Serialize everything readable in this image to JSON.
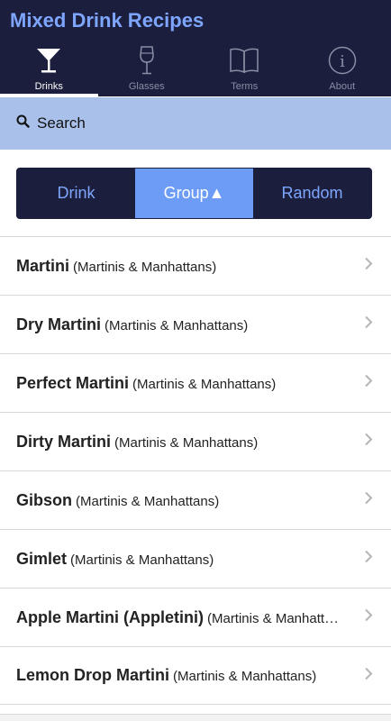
{
  "app": {
    "title": "Mixed Drink Recipes"
  },
  "tabs": [
    {
      "label": "Drinks",
      "icon": "martini-glass-icon",
      "active": true
    },
    {
      "label": "Glasses",
      "icon": "wine-glass-icon",
      "active": false
    },
    {
      "label": "Terms",
      "icon": "book-icon",
      "active": false
    },
    {
      "label": "About",
      "icon": "info-icon",
      "active": false
    }
  ],
  "search": {
    "label": "Search",
    "icon": "search-icon"
  },
  "sort": {
    "options": [
      "Drink",
      "Group▲",
      "Random"
    ],
    "selected": "Group▲"
  },
  "drinks": [
    {
      "name": "Martini",
      "group": "(Martinis & Manhattans)"
    },
    {
      "name": "Dry Martini",
      "group": "(Martinis & Manhattans)"
    },
    {
      "name": "Perfect Martini",
      "group": "(Martinis & Manhattans)"
    },
    {
      "name": "Dirty Martini",
      "group": "(Martinis & Manhattans)"
    },
    {
      "name": "Gibson",
      "group": "(Martinis & Manhattans)"
    },
    {
      "name": "Gimlet",
      "group": "(Martinis & Manhattans)"
    },
    {
      "name": "Apple Martini (Appletini)",
      "group": "(Martinis & Manhattans)"
    },
    {
      "name": "Lemon Drop Martini",
      "group": "(Martinis & Manhattans)"
    }
  ],
  "colors": {
    "header_bg": "#1b1e3c",
    "accent": "#7ea6ff",
    "segment_active": "#6d9cf6",
    "search_bg": "#a9c1ea"
  }
}
